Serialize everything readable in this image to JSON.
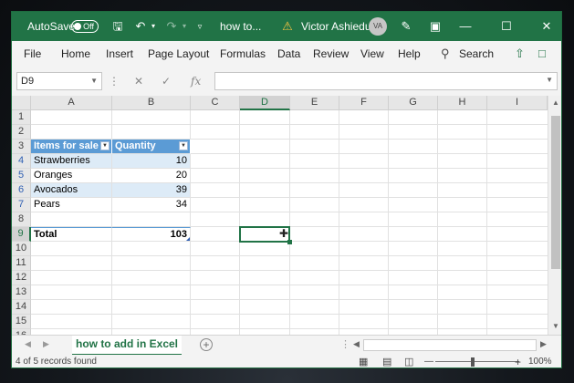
{
  "titlebar": {
    "autosave_label": "AutoSave",
    "autosave_state": "Off",
    "doc_title": "how to...",
    "user_name": "Victor Ashiedu",
    "user_initials": "VA"
  },
  "ribbon": {
    "tabs": [
      "File",
      "Home",
      "Insert",
      "Page Layout",
      "Formulas",
      "Data",
      "Review",
      "View",
      "Help"
    ],
    "search_label": "Search"
  },
  "formula_bar": {
    "name_box": "D9",
    "fx_label": "fx",
    "formula": ""
  },
  "grid": {
    "columns": [
      "A",
      "B",
      "C",
      "D",
      "E",
      "F",
      "G",
      "H",
      "I"
    ],
    "rows": [
      "1",
      "2",
      "3",
      "4",
      "5",
      "6",
      "7",
      "8",
      "9",
      "10",
      "11",
      "12",
      "13",
      "14",
      "15",
      "16"
    ],
    "selected_cell": "D9",
    "table": {
      "headers": [
        "Items for sale",
        "Quantity"
      ],
      "rows": [
        {
          "item": "Strawberries",
          "qty": "10"
        },
        {
          "item": "Oranges",
          "qty": "20"
        },
        {
          "item": "Avocados",
          "qty": "39"
        },
        {
          "item": "Pears",
          "qty": "34"
        }
      ],
      "total_label": "Total",
      "total_value": "103"
    }
  },
  "sheets": {
    "active": "how to add in Excel"
  },
  "status": {
    "records": "4 of 5 records found",
    "zoom": "100%"
  },
  "colors": {
    "accent": "#217346",
    "table_header": "#5b9bd5",
    "table_band": "#ddebf7"
  }
}
